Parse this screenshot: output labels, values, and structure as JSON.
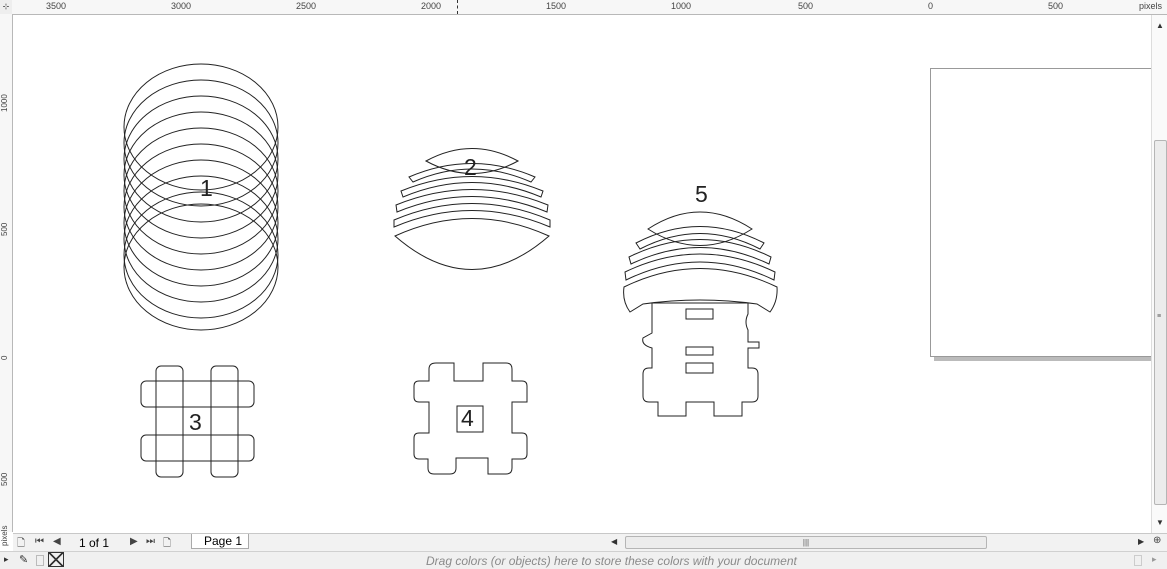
{
  "ruler": {
    "unit": "pixels",
    "top_labels": [
      "3500",
      "3000",
      "2500",
      "2000",
      "1500",
      "1000",
      "500",
      "0",
      "500"
    ],
    "left_labels": [
      "1000",
      "500",
      "0",
      "500"
    ],
    "left_unit": "pixels"
  },
  "shapes": [
    {
      "label": "1"
    },
    {
      "label": "2"
    },
    {
      "label": "3"
    },
    {
      "label": "4"
    },
    {
      "label": "5"
    }
  ],
  "pages": {
    "count_text": "1 of 1",
    "tab_label": "Page 1"
  },
  "status": {
    "hint": "Drag colors (or objects) here to store these colors with your document"
  },
  "colors": {
    "stroke": "#222222",
    "chrome": "#f2f2f2"
  }
}
